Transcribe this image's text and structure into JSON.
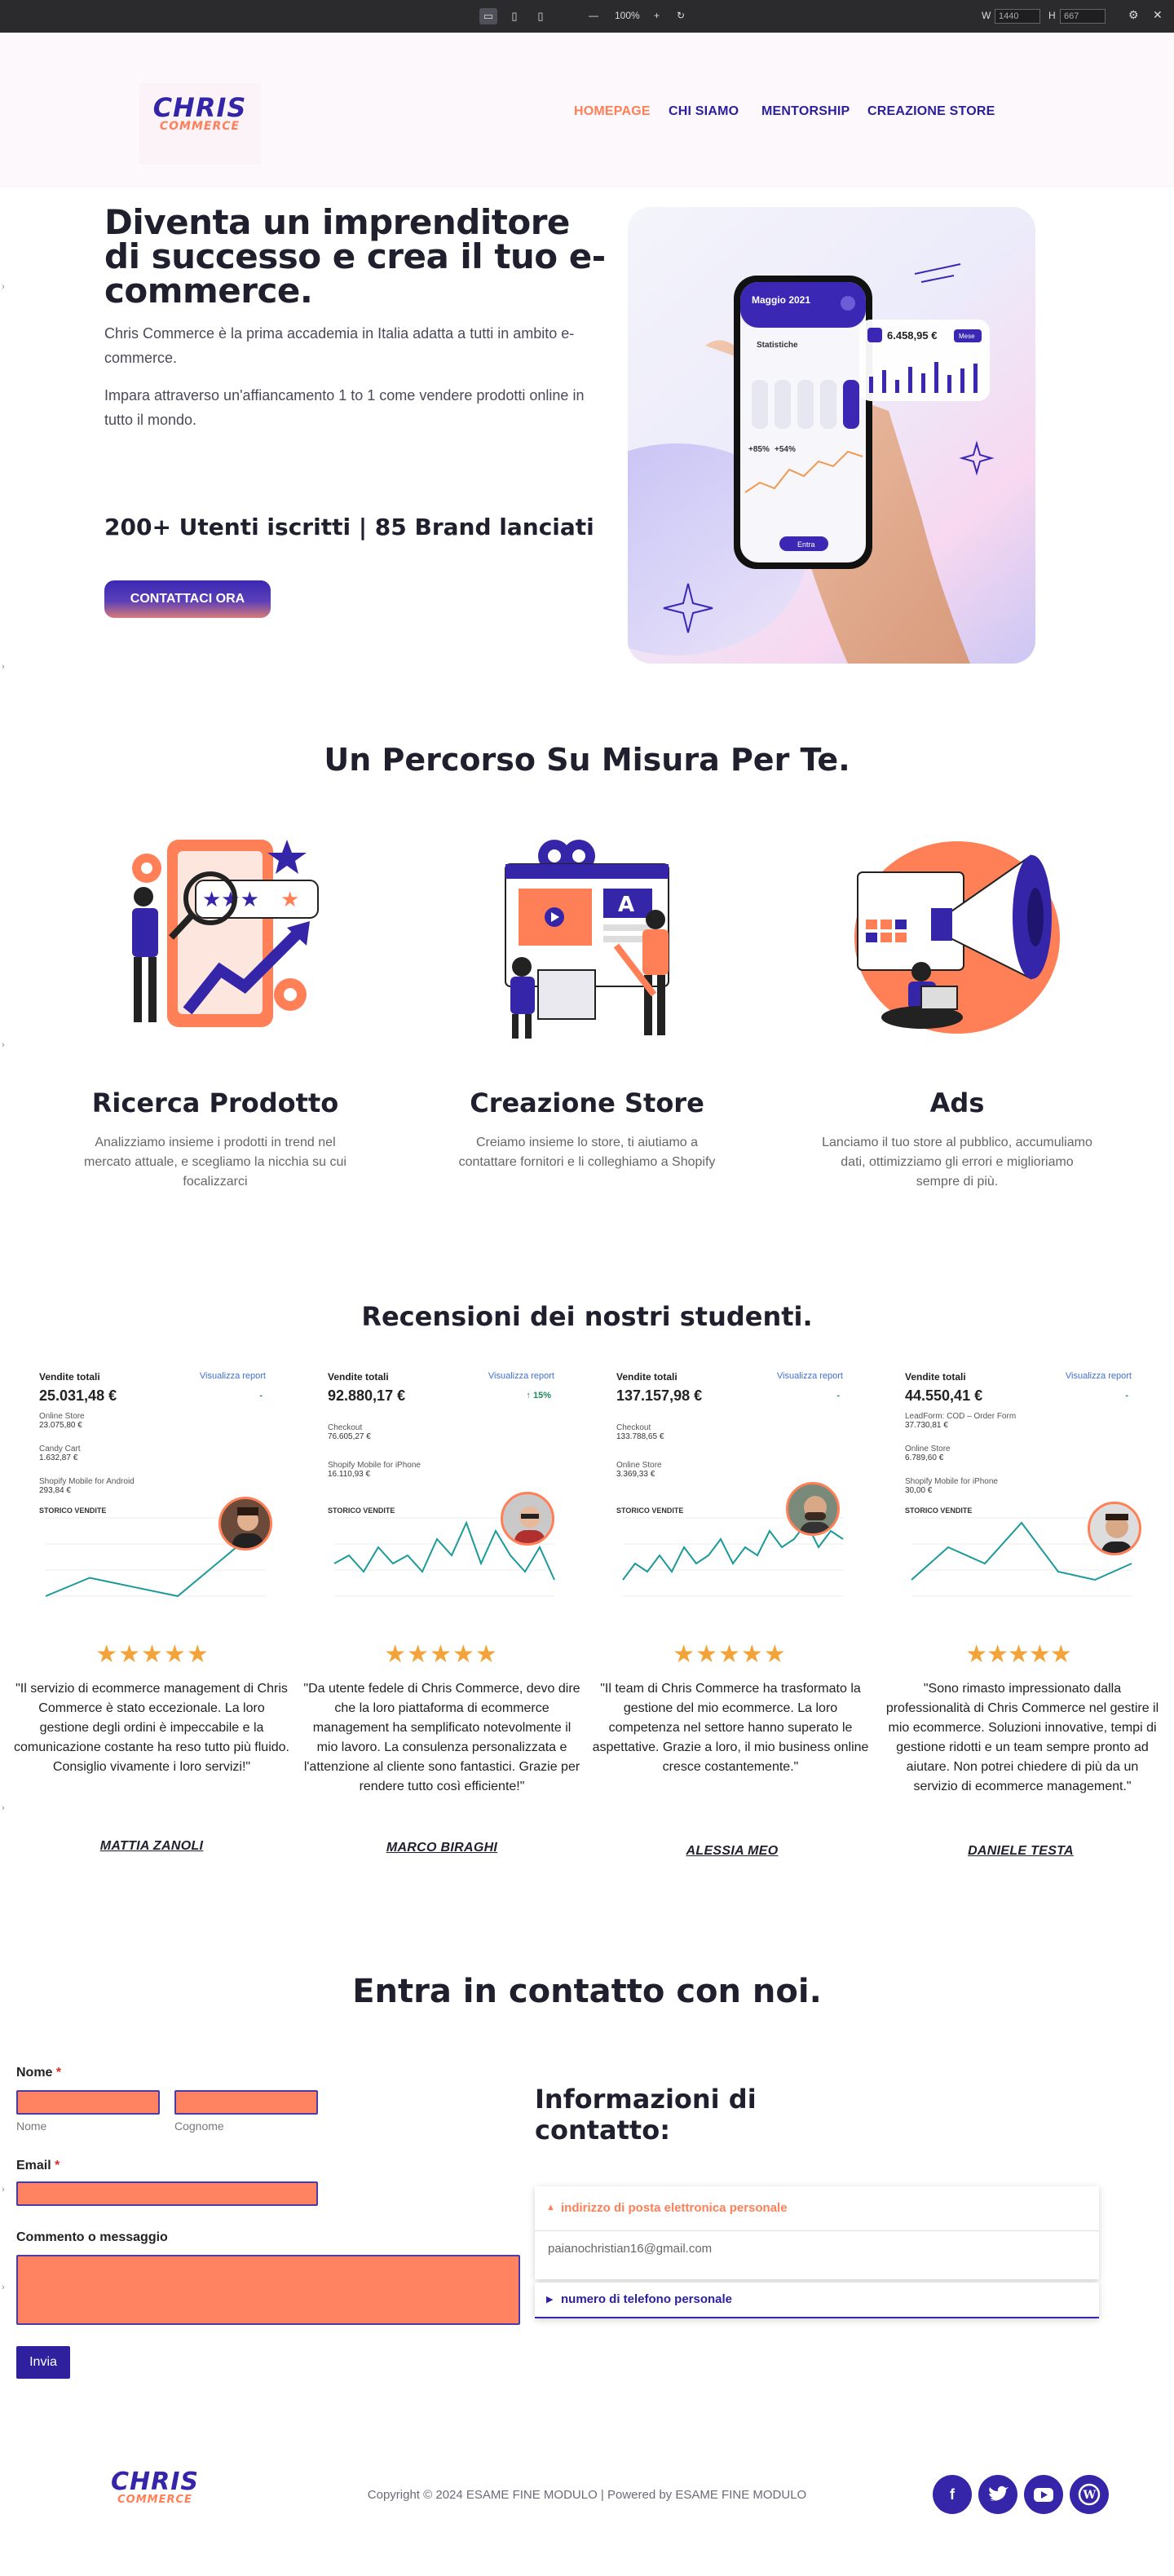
{
  "toolbar": {
    "zoom": "100%",
    "width_label": "W",
    "width_value": "1440",
    "height_label": "H",
    "height_value": "667",
    "minus": "—",
    "plus": "+",
    "reset": "↻",
    "gear": "⚙",
    "close": "✕"
  },
  "header": {
    "logo_line1": "CHRIS",
    "logo_line2": "COMMERCE",
    "nav": [
      "HOMEPAGE",
      "CHI SIAMO",
      "MENTORSHIP",
      "CREAZIONE STORE"
    ],
    "active_nav": "HOMEPAGE"
  },
  "hero": {
    "title": "Diventa un imprenditore di successo e crea il tuo e-commerce.",
    "p1": "Chris Commerce è la prima accademia in Italia adatta a tutti in ambito e-commerce.",
    "p2": "Impara attraverso un'affiancamento 1 to 1 come vendere prodotti online in tutto il mondo.",
    "stats": "200+ Utenti iscritti | 85 Brand lanciati",
    "cta": "CONTATTACI ORA",
    "phone": {
      "month": "Maggio 2021",
      "screen_title": "Statistiche",
      "amount": "6.458,95 €",
      "mini_btn": "Mese",
      "pct1": "+85%",
      "pct2": "+54%",
      "pill": "Entra"
    }
  },
  "services": {
    "title": "Un Percorso Su Misura Per Te.",
    "items": [
      {
        "title": "Ricerca Prodotto",
        "desc": "Analizziamo insieme i prodotti in trend nel mercato attuale, e scegliamo la nicchia su cui focalizzarci"
      },
      {
        "title": "Creazione Store",
        "desc": "Creiamo insieme lo store, ti aiutiamo a contattare fornitori e li colleghiamo a Shopify"
      },
      {
        "title": "Ads",
        "desc": "Lanciamo il tuo store al pubblico, accumuliamo dati, ottimizziamo gli errori e miglioriamo sempre di più."
      }
    ]
  },
  "reviews": {
    "title": "Recensioni dei nostri studenti.",
    "stars": "★★★★★",
    "items": [
      {
        "card_title": "Vendite totali",
        "card_link": "Visualizza report",
        "amount": "25.031,48 €",
        "badge": "-",
        "rows": [
          [
            "Online Store",
            "23.075,80 €"
          ],
          [
            "Candy Cart",
            "1.632,87 €"
          ],
          [
            "Shopify Mobile for Android",
            "293,84 €"
          ]
        ],
        "sales_label": "STORICO VENDITE",
        "quote": "\"Il servizio di ecommerce management di Chris Commerce è stato eccezionale. La loro gestione degli ordini è impeccabile e la comunicazione costante ha reso tutto più fluido. Consiglio vivamente i loro servizi!\"",
        "name": "MATTIA ZANOLI",
        "series": [
          0,
          2,
          1,
          0,
          4,
          8
        ]
      },
      {
        "card_title": "Vendite totali",
        "card_link": "Visualizza report",
        "amount": "92.880,17 €",
        "badge": "↑ 15%",
        "rows": [
          [
            "Checkout",
            "76.605,27 €"
          ],
          [
            "Shopify Mobile for iPhone",
            "16.110,93 €"
          ]
        ],
        "sales_label": "STORICO VENDITE",
        "quote": "\"Da utente fedele di Chris Commerce, devo dire che la loro piattaforma di ecommerce management ha semplificato notevolmente il mio lavoro. La consulenza personalizzata e l'attenzione al cliente sono fantastici. Grazie per rendere tutto così efficiente!\"",
        "name": "MARCO BIRAGHI",
        "series": [
          4,
          5,
          3,
          6,
          4,
          5,
          3,
          7,
          5,
          9,
          4,
          8,
          5,
          3,
          6,
          2
        ]
      },
      {
        "card_title": "Vendite totali",
        "card_link": "Visualizza report",
        "amount": "137.157,98 €",
        "badge": "-",
        "rows": [
          [
            "Checkout",
            "133.788,65 €"
          ],
          [
            "Online Store",
            "3.369,33 €"
          ]
        ],
        "sales_label": "STORICO VENDITE",
        "quote": "\"Il team di Chris Commerce ha trasformato la gestione del mio ecommerce. La loro competenza nel settore  hanno superato le aspettative. Grazie a loro, il mio business online cresce costantemente.\"",
        "name": "ALESSIA MEO",
        "series": [
          2,
          4,
          3,
          5,
          3,
          6,
          4,
          5,
          7,
          4,
          6,
          5,
          8,
          6,
          7,
          9,
          6,
          8,
          7
        ]
      },
      {
        "card_title": "Vendite totali",
        "card_link": "Visualizza report",
        "amount": "44.550,41 €",
        "badge": "-",
        "rows": [
          [
            "LeadForm: COD – Order Form",
            "37.730,81 €"
          ],
          [
            "Online Store",
            "6.789,60 €"
          ],
          [
            "Shopify Mobile for iPhone",
            "30,00 €"
          ]
        ],
        "sales_label": "STORICO VENDITE",
        "quote": "\"Sono rimasto impressionato dalla professionalità di Chris Commerce nel gestire il mio ecommerce. Soluzioni innovative, tempi di gestione ridotti e un team sempre pronto ad aiutare. Non potrei chiedere di più da un servizio di ecommerce management.\"",
        "name": "DANIELE TESTA",
        "series": [
          2,
          6,
          4,
          9,
          3,
          2,
          4
        ]
      }
    ]
  },
  "contact": {
    "title": "Entra in contatto con noi.",
    "name_label": "Nome",
    "required_mark": "*",
    "first_sub": "Nome",
    "last_sub": "Cognome",
    "email_label": "Email",
    "message_label": "Commento o messaggio",
    "submit": "Invia",
    "info_title": "Informazioni di contatto:",
    "accordion": [
      {
        "label": "indirizzo di posta elettronica personale",
        "content": "paianochristian16@gmail.com",
        "open": true
      },
      {
        "label": "numero di telefono personale",
        "open": false
      }
    ]
  },
  "footer": {
    "logo_line1": "CHRIS",
    "logo_line2": "COMMERCE",
    "copyright": "Copyright © 2024 ESAME FINE MODULO | Powered by ESAME FINE MODULO",
    "social": [
      "facebook",
      "twitter",
      "youtube",
      "wordpress"
    ]
  },
  "colors": {
    "brand": "#3525a8",
    "accent": "#ff7f57",
    "nav_active": "#ff7f57"
  }
}
